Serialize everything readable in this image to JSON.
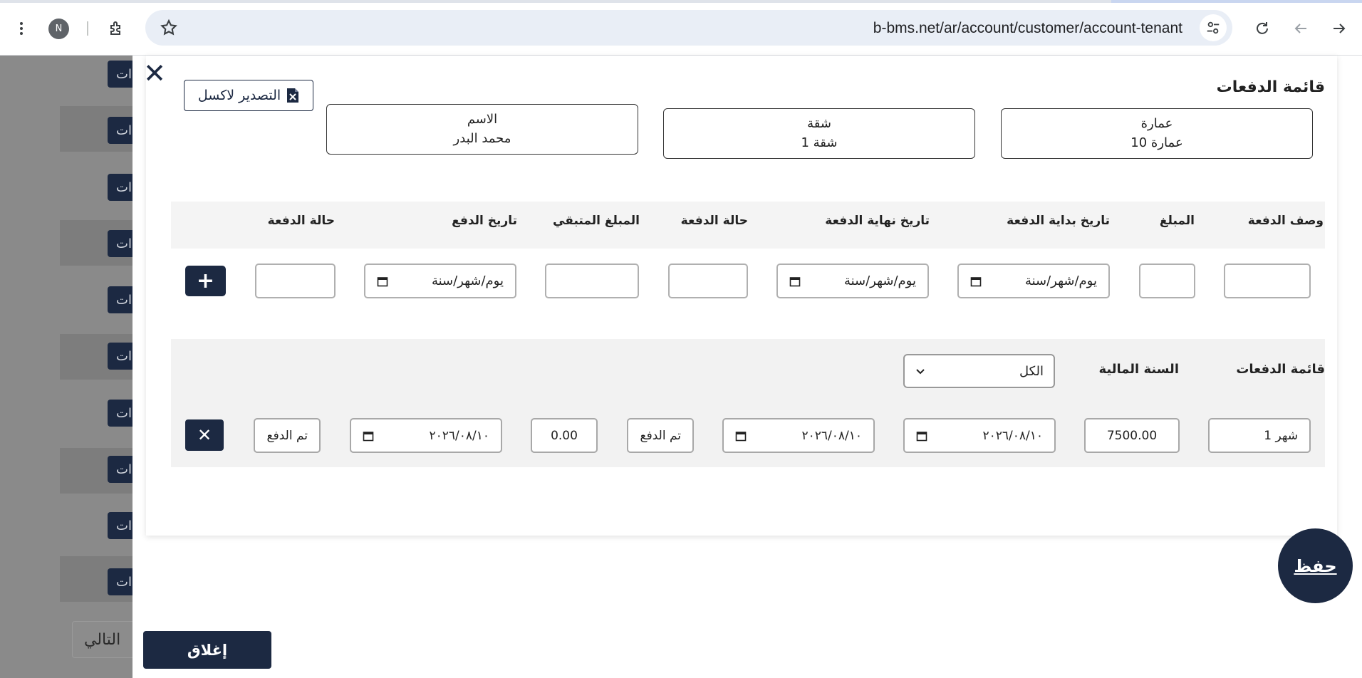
{
  "browser": {
    "avatar_letter": "N",
    "url": "b-bms.net/ar/account/customer/account-tenant"
  },
  "background": {
    "row_button_fragment": "ات",
    "next_label": "التالي"
  },
  "modal": {
    "title": "قائمة الدفعات",
    "export_label": "التصدير لاكسل",
    "info": {
      "building": {
        "label": "عمارة",
        "value": "عمارة 10"
      },
      "apartment": {
        "label": "شقة",
        "value": "شقة 1"
      },
      "name": {
        "label": "الاسم",
        "value": "محمد البدر"
      }
    },
    "new_payment": {
      "headers": {
        "description": "وصف الدفعة",
        "amount": "المبلغ",
        "start_date": "تاريخ بداية الدفعة",
        "end_date": "تاريخ نهاية الدفعة",
        "status": "حالة الدفعة",
        "remaining": "المبلغ المتبقي",
        "pay_date": "تاريخ الدفع",
        "status2": "حالة الدفعة"
      },
      "date_placeholder": "يوم/شهر/سنة"
    },
    "list": {
      "title": "قائمة الدفعات",
      "fiscal_year_label": "السنة المالية",
      "fiscal_year_value": "الكل",
      "rows": [
        {
          "description": "شهر 1",
          "amount": "7500.00",
          "start_date": "٢٠٢٦/٠٨/١٠",
          "end_date": "٢٠٢٦/٠٨/١٠",
          "status": "تم الدفع",
          "remaining": "0.00",
          "pay_date": "٢٠٢٦/٠٨/١٠",
          "status2": "تم الدفع"
        }
      ]
    },
    "save_label": "حفظ",
    "close_label": "إغلاق"
  },
  "colors": {
    "primary": "#1c2942",
    "overlay": "#8a8a8a"
  }
}
